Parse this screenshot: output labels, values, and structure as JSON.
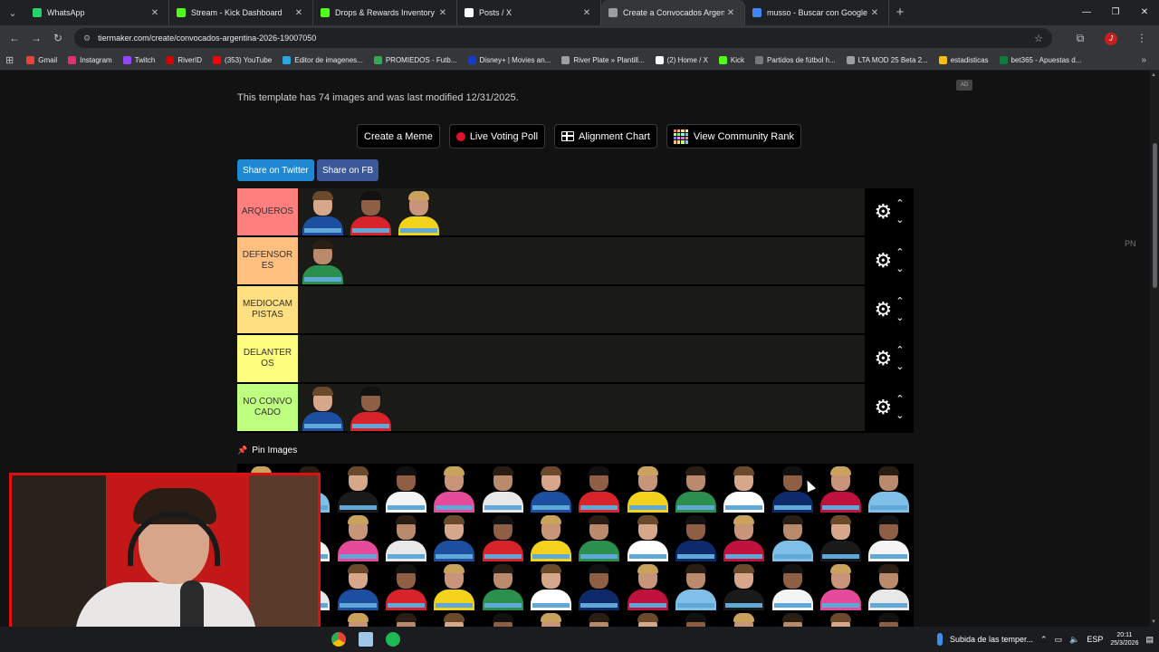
{
  "browser": {
    "tabs": [
      {
        "label": "WhatsApp",
        "color": "#25d366",
        "active": false
      },
      {
        "label": "Stream - Kick Dashboard",
        "color": "#53fc18",
        "active": false
      },
      {
        "label": "Drops & Rewards Inventory - K",
        "color": "#53fc18",
        "active": false
      },
      {
        "label": "Posts / X",
        "color": "#ffffff",
        "active": false
      },
      {
        "label": "Create a Convocados Argentina",
        "color": "#9e9e9e",
        "active": true
      },
      {
        "label": "musso - Buscar con Google",
        "color": "#4285f4",
        "active": false
      }
    ],
    "new_tab": "+",
    "url": "tiermaker.com/create/convocados-argentina-2026-19007050",
    "bookmarks": [
      {
        "label": "Gmail",
        "color": "#ea4335"
      },
      {
        "label": "Instagram",
        "color": "#e1306c"
      },
      {
        "label": "Twitch",
        "color": "#9146ff"
      },
      {
        "label": "RiverID",
        "color": "#d50000"
      },
      {
        "label": "(353) YouTube",
        "color": "#ff0000"
      },
      {
        "label": "Editor de imagenes...",
        "color": "#2aa7e0"
      },
      {
        "label": "PROMIEDOS - Futb...",
        "color": "#34a853"
      },
      {
        "label": "Disney+ | Movies an...",
        "color": "#113ccf"
      },
      {
        "label": "River Plate » Plantill...",
        "color": "#9e9e9e"
      },
      {
        "label": "(2) Home / X",
        "color": "#ffffff"
      },
      {
        "label": "Kick",
        "color": "#53fc18"
      },
      {
        "label": "Partidos de fútbol h...",
        "color": "#777777"
      },
      {
        "label": "LTA MOD 25 Beta 2...",
        "color": "#9e9e9e"
      },
      {
        "label": "estadisticas",
        "color": "#fbbc04"
      },
      {
        "label": "bet365 - Apuestas d...",
        "color": "#127a3e"
      }
    ]
  },
  "page": {
    "info_text": "This template has 74 images and was last modified 12/31/2025.",
    "ad_label": "AD",
    "pn_label": "PN",
    "buttons": {
      "create_meme": "Create a Meme",
      "live_voting": "Live Voting Poll",
      "alignment_chart": "Alignment Chart",
      "community_rank": "View Community Rank"
    },
    "share": {
      "twitter": "Share on Twitter",
      "facebook": "Share on FB"
    },
    "tiers": [
      {
        "label": "ARQUEROS",
        "color": "#ff7f7f",
        "players": 3
      },
      {
        "label": "DEFENSORES",
        "color": "#ffbf7f",
        "players": 1
      },
      {
        "label": "MEDIOCAMPISTAS",
        "color": "#ffdf7f",
        "players": 0
      },
      {
        "label": "DELANTEROS",
        "color": "#ffff7f",
        "players": 0
      },
      {
        "label": "NO CONVOCADO",
        "color": "#bfff7f",
        "players": 2
      }
    ],
    "pin_images": "Pin Images"
  },
  "taskbar": {
    "weather": "Subida de las temper...",
    "lang": "ESP",
    "time": "20:11",
    "date": "25/3/2026"
  }
}
